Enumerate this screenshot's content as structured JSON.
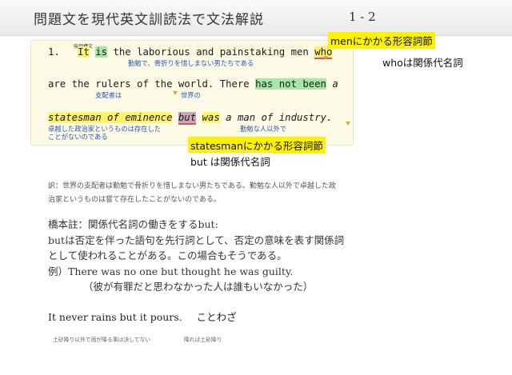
{
  "header": {
    "title": "問題文を現代英文訓読法で文法解説",
    "page": "1 - 2"
  },
  "sentence": {
    "line1": {
      "num": "1.",
      "it": "It",
      "is": "is",
      "rest": " the laborious and painstaking ",
      "men": "men",
      "who": "who"
    },
    "line2": {
      "start": "are the rulers of the world.  There ",
      "has_not_been": "has not been",
      "a": "a"
    },
    "line3": {
      "statesman": "statesman of eminence",
      "but": "but",
      "was": "was",
      "rest": "a man of industry",
      "period": "."
    },
    "small_label": "強調構文",
    "glosses": {
      "g1": "勤勉で、骨折りを惜しまない男たちである",
      "g2": "支配者は",
      "g3": "世界の",
      "g4_1": "卓越した政治家というものは存在した",
      "g4_2": "ことがないのである",
      "g5": "勤勉な人以外で"
    }
  },
  "tags": {
    "men_clause": "menにかかる形容詞節",
    "who_rel": "whoは関係代名詞",
    "statesman_clause": "statesmanにかかる形容詞節",
    "but_rel": "but は関係代名詞"
  },
  "translation": {
    "line1": "訳：世界の支配者は勤勉で骨折りを惜しまない男たちである。勤勉な人以外で卓越した政",
    "line2": "治家というものは嘗て存在したことがないのである。"
  },
  "note": {
    "heading": "橋本註：関係代名詞の働きをするbut:",
    "line1": "butは否定を伴った語句を先行詞として、否定の意味を表す関係詞",
    "line2": "として使われることがある。この場合もそうである。",
    "line3": "例）There was no one but thought he was guilty.",
    "line4": "（彼が有罪だと思わなかった人は誰もいなかった）"
  },
  "proverb": {
    "text": "It never rains but it pours.",
    "label": "ことわざ"
  },
  "footer": {
    "left": "土砂降り以外で雨が降る事は決してない",
    "right": "降れば土砂降り"
  }
}
